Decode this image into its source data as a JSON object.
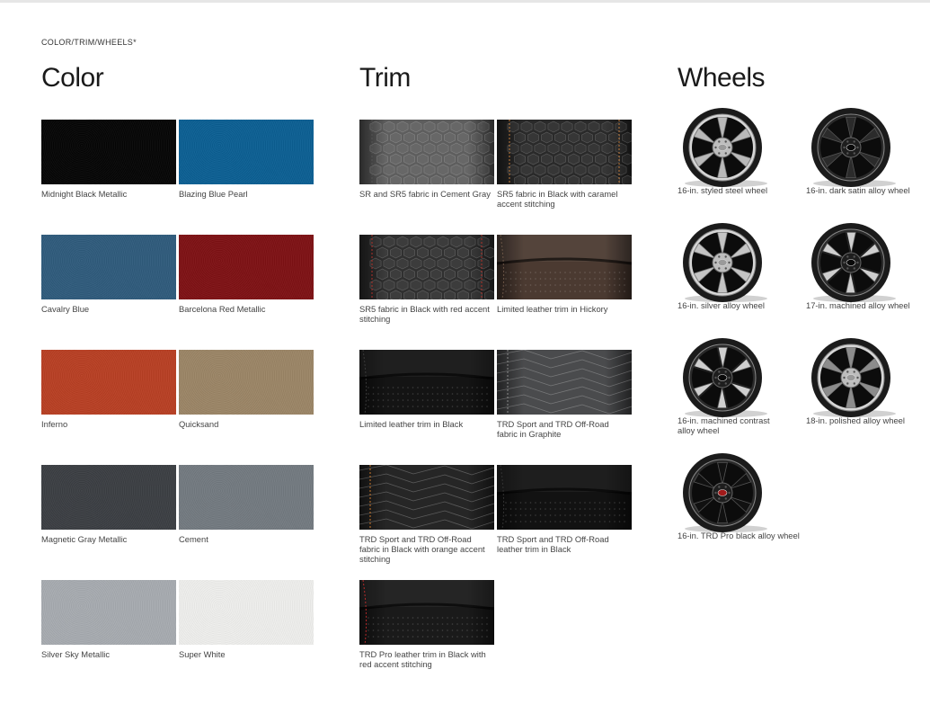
{
  "section_label": "COLOR/TRIM/WHEELS*",
  "color": {
    "heading": "Color",
    "items": [
      {
        "name": "Midnight Black Metallic",
        "hex": "#050505"
      },
      {
        "name": "Blazing Blue Pearl",
        "hex": "#0b5f93"
      },
      {
        "name": "Cavalry Blue",
        "hex": "#2f5b7c"
      },
      {
        "name": "Barcelona Red Metallic",
        "hex": "#7e1114"
      },
      {
        "name": "Inferno",
        "hex": "#b83f23"
      },
      {
        "name": "Quicksand",
        "hex": "#9b8566"
      },
      {
        "name": "Magnetic Gray Metallic",
        "hex": "#3b3e43"
      },
      {
        "name": "Cement",
        "hex": "#737a80"
      },
      {
        "name": "Silver Sky Metallic",
        "hex": "#a7abb0"
      },
      {
        "name": "Super White",
        "hex": "#eeeeec"
      }
    ]
  },
  "trim": {
    "heading": "Trim",
    "items": [
      {
        "name": "SR and SR5 fabric in Cement Gray",
        "base": "#5e5e5e"
      },
      {
        "name": "SR5 fabric in Black with caramel accent stitching",
        "base": "#2a2a2a"
      },
      {
        "name": "SR5 fabric in Black with red accent stitching",
        "base": "#303030"
      },
      {
        "name": "Limited leather trim in Hickory",
        "base": "#4b3a31"
      },
      {
        "name": "Limited leather trim in Black",
        "base": "#141414"
      },
      {
        "name": "TRD Sport and TRD Off-Road fabric in Graphite",
        "base": "#4a4b4d"
      },
      {
        "name": "TRD Sport and TRD Off-Road fabric in Black with orange accent stitching",
        "base": "#262626"
      },
      {
        "name": "TRD Sport and TRD Off-Road leather trim in Black",
        "base": "#121212"
      },
      {
        "name": "TRD Pro leather trim in Black with red accent stitching",
        "base": "#1a1a1a"
      }
    ]
  },
  "wheels": {
    "heading": "Wheels",
    "items": [
      {
        "name": "16-in. styled steel wheel",
        "finish": "#b9b9b9"
      },
      {
        "name": "16-in. dark satin alloy wheel",
        "finish": "#2b2b2b"
      },
      {
        "name": "16-in. silver alloy wheel",
        "finish": "#c4c4c4"
      },
      {
        "name": "17-in. machined alloy wheel",
        "finish": "#3a3a3a"
      },
      {
        "name": "16-in. machined contrast alloy wheel",
        "finish": "#505050"
      },
      {
        "name": "18-in. polished alloy wheel",
        "finish": "#8c8c8c"
      },
      {
        "name": "16-in. TRD Pro black alloy wheel",
        "finish": "#111111"
      }
    ]
  }
}
